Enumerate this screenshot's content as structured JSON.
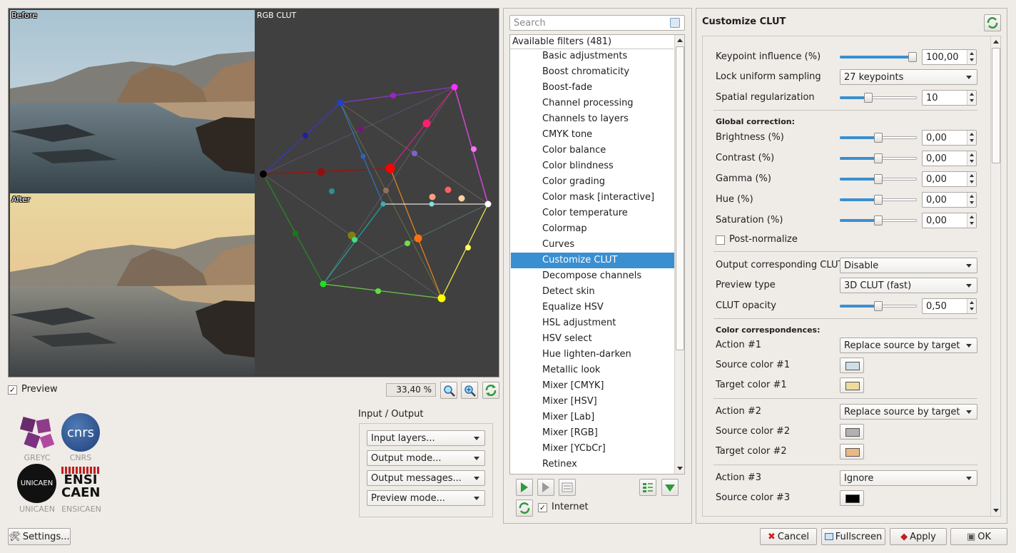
{
  "preview": {
    "before_label": "Before",
    "after_label": "After",
    "clut_label": "RGB CLUT",
    "preview_checkbox_label": "Preview",
    "preview_checked": true,
    "zoom_value": "33,40 %"
  },
  "logos": {
    "greyc": "GREYC",
    "cnrs": "CNRS",
    "cnrs_mark": "cnrs",
    "unicaen": "UNICAEN",
    "unicaen_mark": "UNICAEN",
    "ensicaen": "ENSICAEN",
    "ensi_mark_1": "ENSI",
    "ensi_mark_2": "CAEN"
  },
  "io": {
    "title": "Input / Output",
    "input_layers": "Input layers...",
    "output_mode": "Output mode...",
    "output_messages": "Output messages...",
    "preview_mode": "Preview mode..."
  },
  "settings_button": "Settings...",
  "filters": {
    "search_placeholder": "Search",
    "header": "Available filters (481)",
    "items": [
      "Basic adjustments",
      "Boost chromaticity",
      "Boost-fade",
      "Channel processing",
      "Channels to layers",
      "CMYK tone",
      "Color balance",
      "Color blindness",
      "Color grading",
      "Color mask [interactive]",
      "Color temperature",
      "Colormap",
      "Curves",
      "Customize CLUT",
      "Decompose channels",
      "Detect skin",
      "Equalize HSV",
      "HSL adjustment",
      "HSV select",
      "Hue lighten-darken",
      "Metallic look",
      "Mixer [CMYK]",
      "Mixer [HSV]",
      "Mixer [Lab]",
      "Mixer [RGB]",
      "Mixer [YCbCr]",
      "Retinex"
    ],
    "selected": "Customize CLUT",
    "internet_label": "Internet",
    "internet_checked": true
  },
  "params": {
    "title": "Customize CLUT",
    "keypoint_influence": {
      "label": "Keypoint influence (%)",
      "value": "100,00",
      "level": 1.0
    },
    "lock_uniform_sampling": {
      "label": "Lock uniform sampling",
      "value": "27 keypoints"
    },
    "spatial_regularization": {
      "label": "Spatial regularization",
      "value": "10",
      "level": 0.35
    },
    "global_correction": "Global correction:",
    "brightness": {
      "label": "Brightness (%)",
      "value": "0,00",
      "level": 0.5
    },
    "contrast": {
      "label": "Contrast (%)",
      "value": "0,00",
      "level": 0.5
    },
    "gamma": {
      "label": "Gamma (%)",
      "value": "0,00",
      "level": 0.5
    },
    "hue": {
      "label": "Hue (%)",
      "value": "0,00",
      "level": 0.5
    },
    "saturation": {
      "label": "Saturation (%)",
      "value": "0,00",
      "level": 0.5
    },
    "post_normalize": "Post-normalize",
    "output_clut": {
      "label": "Output corresponding CLUT",
      "value": "Disable"
    },
    "preview_type": {
      "label": "Preview type",
      "value": "3D CLUT (fast)"
    },
    "clut_opacity": {
      "label": "CLUT opacity",
      "value": "0,50",
      "level": 0.5
    },
    "color_correspondences": "Color correspondences:",
    "action1": {
      "label": "Action #1",
      "value": "Replace source by target"
    },
    "source1": {
      "label": "Source color #1",
      "color": "#cfdde6"
    },
    "target1": {
      "label": "Target color #1",
      "color": "#eedc9e"
    },
    "action2": {
      "label": "Action #2",
      "value": "Replace source by target"
    },
    "source2": {
      "label": "Source color #2",
      "color": "#b1b1b1"
    },
    "target2": {
      "label": "Target color #2",
      "color": "#ebb883"
    },
    "action3": {
      "label": "Action #3",
      "value": "Ignore"
    },
    "source3": {
      "label": "Source color #3",
      "color": "#000000"
    }
  },
  "buttons": {
    "cancel": "Cancel",
    "fullscreen": "Fullscreen",
    "apply": "Apply",
    "ok": "OK"
  },
  "colors": {
    "accent": "#3a8fd0",
    "clut_bg": "#404040"
  }
}
